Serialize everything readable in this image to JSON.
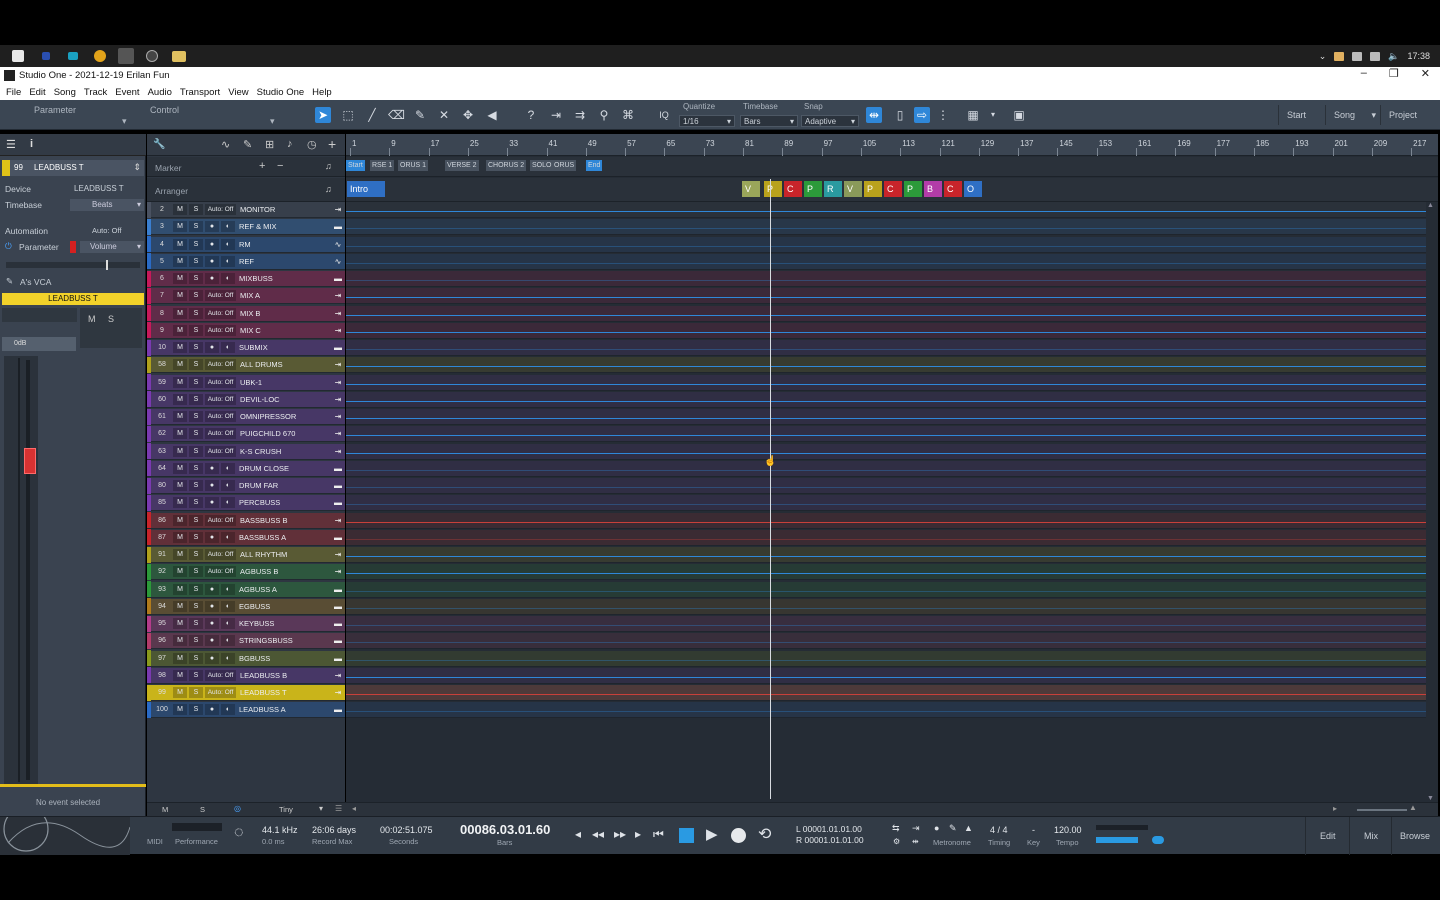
{
  "window": {
    "title": "Studio One - 2021-12-19 Erilan Fun",
    "clock": "17:38",
    "controls": [
      "–",
      "❐",
      "✕"
    ]
  },
  "menu": [
    "File",
    "Edit",
    "Song",
    "Track",
    "Event",
    "Audio",
    "Transport",
    "View",
    "Studio One",
    "Help"
  ],
  "toolbar": {
    "parameter_label": "Parameter",
    "control_label": "Control",
    "iq_label": "IQ",
    "quantize_label": "Quantize",
    "quantize_value": "1/16",
    "timebase_label": "Timebase",
    "timebase_value": "Bars",
    "snap_label": "Snap",
    "snap_value": "Adaptive",
    "right_buttons": [
      "Start",
      "Song",
      "Project"
    ]
  },
  "inspector": {
    "track_number": "99",
    "track_name": "LEADBUSS T",
    "device_label": "Device",
    "device_value": "LEADBUSS T",
    "timebase_label": "Timebase",
    "timebase_value": "Beats",
    "automation_label": "Automation",
    "automation_value": "Auto: Off",
    "parameter_label": "Parameter",
    "parameter_value": "Volume",
    "vca_label": "A's VCA",
    "channel_name": "LEADBUSS T",
    "mute": "M",
    "solo": "S",
    "fader_value": "0dB",
    "no_event": "No event selected"
  },
  "arrange_header": {
    "marker_label": "Marker",
    "arranger_label": "Arranger",
    "markers": [
      "Start",
      "RSE 1",
      "ORUS 1",
      "VERSE 2",
      "CHORUS 2",
      "SOLO",
      "ORUS",
      "End"
    ],
    "sections": [
      {
        "label": "Intro",
        "color": "#2f6fc4"
      },
      {
        "label": "V",
        "color": "#9aa65a"
      },
      {
        "label": "P",
        "color": "#b9a21c"
      },
      {
        "label": "C",
        "color": "#c8242a"
      },
      {
        "label": "P",
        "color": "#2c9a3a"
      },
      {
        "label": "R",
        "color": "#2a9aa0"
      },
      {
        "label": "V",
        "color": "#8a9a5a"
      },
      {
        "label": "P",
        "color": "#b9a21c"
      },
      {
        "label": "C",
        "color": "#c8242a"
      },
      {
        "label": "P",
        "color": "#2c9a3a"
      },
      {
        "label": "B",
        "color": "#b33ca8"
      },
      {
        "label": "C",
        "color": "#c8242a"
      },
      {
        "label": "O",
        "color": "#2f6fc4"
      }
    ]
  },
  "ruler": {
    "bars": [
      "1",
      "9",
      "17",
      "25",
      "33",
      "41",
      "49",
      "57",
      "65",
      "73",
      "81",
      "89",
      "97",
      "105",
      "113",
      "121",
      "129",
      "137",
      "145",
      "153",
      "161",
      "169",
      "177",
      "185",
      "193",
      "201",
      "209",
      "217"
    ]
  },
  "tracks": [
    {
      "num": "2",
      "name": "MONITOR",
      "color": "#4a5261",
      "auto": "Auto: Off",
      "icon": "⇥"
    },
    {
      "num": "3",
      "name": "REF & MIX",
      "color": "#3a7fd0",
      "auto": "",
      "icon": "▬"
    },
    {
      "num": "4",
      "name": "RM",
      "color": "#2a6bc6",
      "auto": "",
      "icon": "∿"
    },
    {
      "num": "5",
      "name": "REF",
      "color": "#2a6bc6",
      "auto": "",
      "icon": "∿"
    },
    {
      "num": "6",
      "name": "MIXBUSS",
      "color": "#c7195a",
      "auto": "",
      "icon": "▬"
    },
    {
      "num": "7",
      "name": "MIX A",
      "color": "#c7195a",
      "auto": "Auto: Off",
      "icon": "⇥"
    },
    {
      "num": "8",
      "name": "MIX B",
      "color": "#c7195a",
      "auto": "Auto: Off",
      "icon": "⇥"
    },
    {
      "num": "9",
      "name": "MIX C",
      "color": "#c7195a",
      "auto": "Auto: Off",
      "icon": "⇥"
    },
    {
      "num": "10",
      "name": "SUBMIX",
      "color": "#7a3ab0",
      "auto": "",
      "icon": "▬"
    },
    {
      "num": "58",
      "name": "ALL DRUMS",
      "color": "#b0a11c",
      "auto": "Auto: Off",
      "icon": "⇥"
    },
    {
      "num": "59",
      "name": "UBK-1",
      "color": "#7a3ab0",
      "auto": "Auto: Off",
      "icon": "⇥"
    },
    {
      "num": "60",
      "name": "DEVIL-LOC",
      "color": "#7a3ab0",
      "auto": "Auto: Off",
      "icon": "⇥"
    },
    {
      "num": "61",
      "name": "OMNIPRESSOR",
      "color": "#7a3ab0",
      "auto": "Auto: Off",
      "icon": "⇥"
    },
    {
      "num": "62",
      "name": "PUIGCHILD 670",
      "color": "#7a3ab0",
      "auto": "Auto: Off",
      "icon": "⇥"
    },
    {
      "num": "63",
      "name": "K-S CRUSH",
      "color": "#7a3ab0",
      "auto": "Auto: Off",
      "icon": "⇥"
    },
    {
      "num": "64",
      "name": "DRUM CLOSE",
      "color": "#7a3ab0",
      "auto": "",
      "icon": "▬"
    },
    {
      "num": "80",
      "name": "DRUM FAR",
      "color": "#7a3ab0",
      "auto": "",
      "icon": "▬"
    },
    {
      "num": "85",
      "name": "PERCBUSS",
      "color": "#7a3ab0",
      "auto": "",
      "icon": "▬"
    },
    {
      "num": "86",
      "name": "BASSBUSS B",
      "color": "#c8242a",
      "auto": "Auto: Off",
      "icon": "⇥"
    },
    {
      "num": "87",
      "name": "BASSBUSS A",
      "color": "#c8242a",
      "auto": "",
      "icon": "▬"
    },
    {
      "num": "91",
      "name": "ALL RHYTHM",
      "color": "#b0a11c",
      "auto": "Auto: Off",
      "icon": "⇥"
    },
    {
      "num": "92",
      "name": "AGBUSS B",
      "color": "#2c9a3a",
      "auto": "Auto: Off",
      "icon": "⇥"
    },
    {
      "num": "93",
      "name": "AGBUSS A",
      "color": "#2c9a3a",
      "auto": "",
      "icon": "▬"
    },
    {
      "num": "94",
      "name": "EGBUSS",
      "color": "#b07b1c",
      "auto": "",
      "icon": "▬"
    },
    {
      "num": "95",
      "name": "KEYBUSS",
      "color": "#b33c8a",
      "auto": "",
      "icon": "▬"
    },
    {
      "num": "96",
      "name": "STRINGSBUSS",
      "color": "#b33c6a",
      "auto": "",
      "icon": "▬"
    },
    {
      "num": "97",
      "name": "BGBUSS",
      "color": "#8a9a1c",
      "auto": "",
      "icon": "▬"
    },
    {
      "num": "98",
      "name": "LEADBUSS B",
      "color": "#7a3ab0",
      "auto": "Auto: Off",
      "icon": "⇥"
    },
    {
      "num": "99",
      "name": "LEADBUSS T",
      "color": "#c9b41a",
      "auto": "Auto: Off",
      "icon": "⇥"
    },
    {
      "num": "100",
      "name": "LEADBUSS A",
      "color": "#2a6bc6",
      "auto": "",
      "icon": "▬"
    }
  ],
  "bottom_strip": {
    "m": "M",
    "s": "S",
    "size": "Tiny"
  },
  "transport": {
    "midi_label": "MIDI",
    "performance_label": "Performance",
    "sample_rate": "44.1 kHz",
    "latency": "0.0 ms",
    "record_max_value": "26:06 days",
    "record_max_label": "Record Max",
    "seconds_value": "00:02:51.075",
    "seconds_label": "Seconds",
    "position": "00086.03.01.60",
    "position_label": "Bars",
    "loop_left": "L  00001.01.01.00",
    "loop_right": "R  00001.01.01.00",
    "metronome_label": "Metronome",
    "timing_value": "4 / 4",
    "timing_label": "Timing",
    "key_value": "-",
    "key_label": "Key",
    "tempo_value": "120.00",
    "tempo_label": "Tempo",
    "views": [
      "Edit",
      "Mix",
      "Browse"
    ]
  }
}
